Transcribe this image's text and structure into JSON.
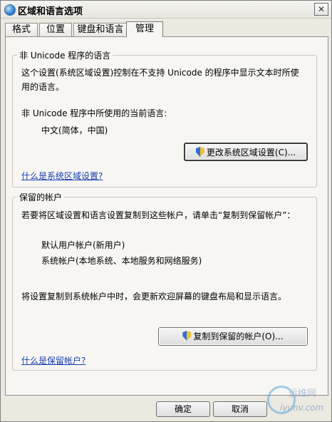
{
  "window": {
    "title": "区域和语言选项",
    "close_label": "✕"
  },
  "tabs": [
    {
      "label": "格式",
      "active": false
    },
    {
      "label": "位置",
      "active": false
    },
    {
      "label": "键盘和语言",
      "active": false
    },
    {
      "label": "管理",
      "active": true
    }
  ],
  "group_nonunicode": {
    "legend": "非 Unicode 程序的语言",
    "description": "这个设置(系统区域设置)控制在不支持 Unicode 的程序中显示文本时所使用的语言。",
    "current_label": "非 Unicode 程序中所使用的当前语言:",
    "current_value": "中文(简体，中国)",
    "button_label": "更改系统区域设置(C)...",
    "link": "什么是系统区域设置?"
  },
  "group_reserved": {
    "legend": "保留的帐户",
    "description": "若要将区域设置和语言设置复制到这些帐户，请单击“复制到保留帐户”：",
    "account1": "默认用户帐户(新用户)",
    "account2": "系统帐户(本地系统、本地服务和网络服务)",
    "note": "将设置复制到系统帐户中时，会更新欢迎屏幕的键盘布局和显示语言。",
    "button_label": "复制到保留的帐户(O)...",
    "link": "什么是保留帐户?"
  },
  "footer": {
    "ok_label": "确定",
    "cancel_label": "取消"
  },
  "watermark": {
    "text1": "运维网",
    "text2": "iyunv.com"
  }
}
